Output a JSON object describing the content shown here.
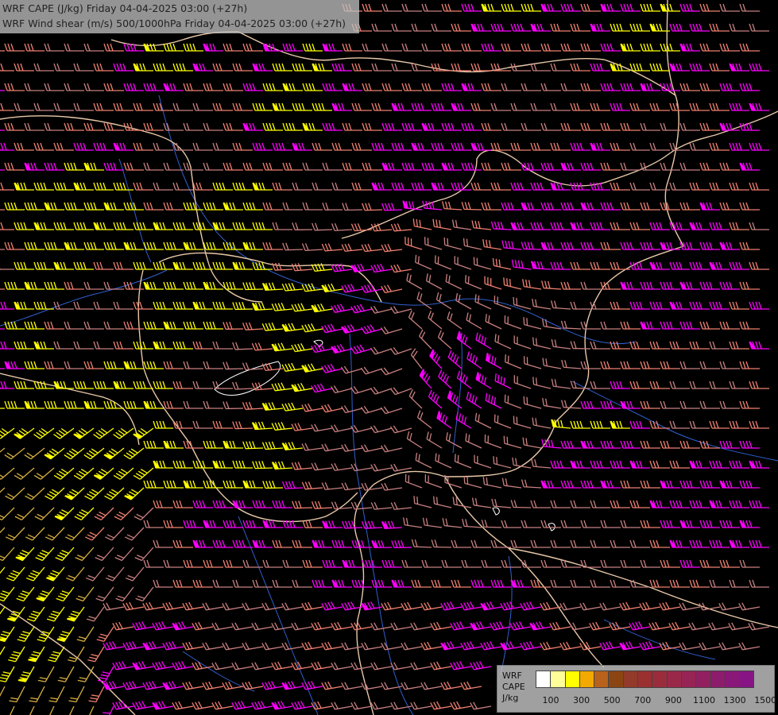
{
  "title": {
    "line1": "WRF CAPE (J/kg) Friday 04-04-2025 03:00 (+27h)",
    "line2": "WRF Wind shear (m/s) 500/1000hPa Friday 04-04-2025 03:00 (+27h)"
  },
  "legend": {
    "label_model": "WRF",
    "label_field": "CAPE",
    "label_unit": "J/kg",
    "colors": [
      "#ffffff",
      "#ffff99",
      "#ffff00",
      "#f2a900",
      "#b8621b",
      "#8b4513",
      "#933a2a",
      "#9a3030",
      "#9b2c3c",
      "#9a2848",
      "#962454",
      "#922060",
      "#8e1c6c",
      "#8a1878",
      "#861484"
    ],
    "ticks": [
      "100",
      "300",
      "500",
      "700",
      "900",
      "1100",
      "1300",
      "1500"
    ]
  },
  "barb_palette": {
    "yellow": "#ffff00",
    "magenta": "#ff00ff",
    "salmon": "#f08070",
    "rose": "#c88080",
    "gold": "#d8b040"
  },
  "map_colors": {
    "background": "#000000",
    "borders": "#e8c8a8",
    "rivers": "#3060d0",
    "lakes": "#ffffff"
  }
}
